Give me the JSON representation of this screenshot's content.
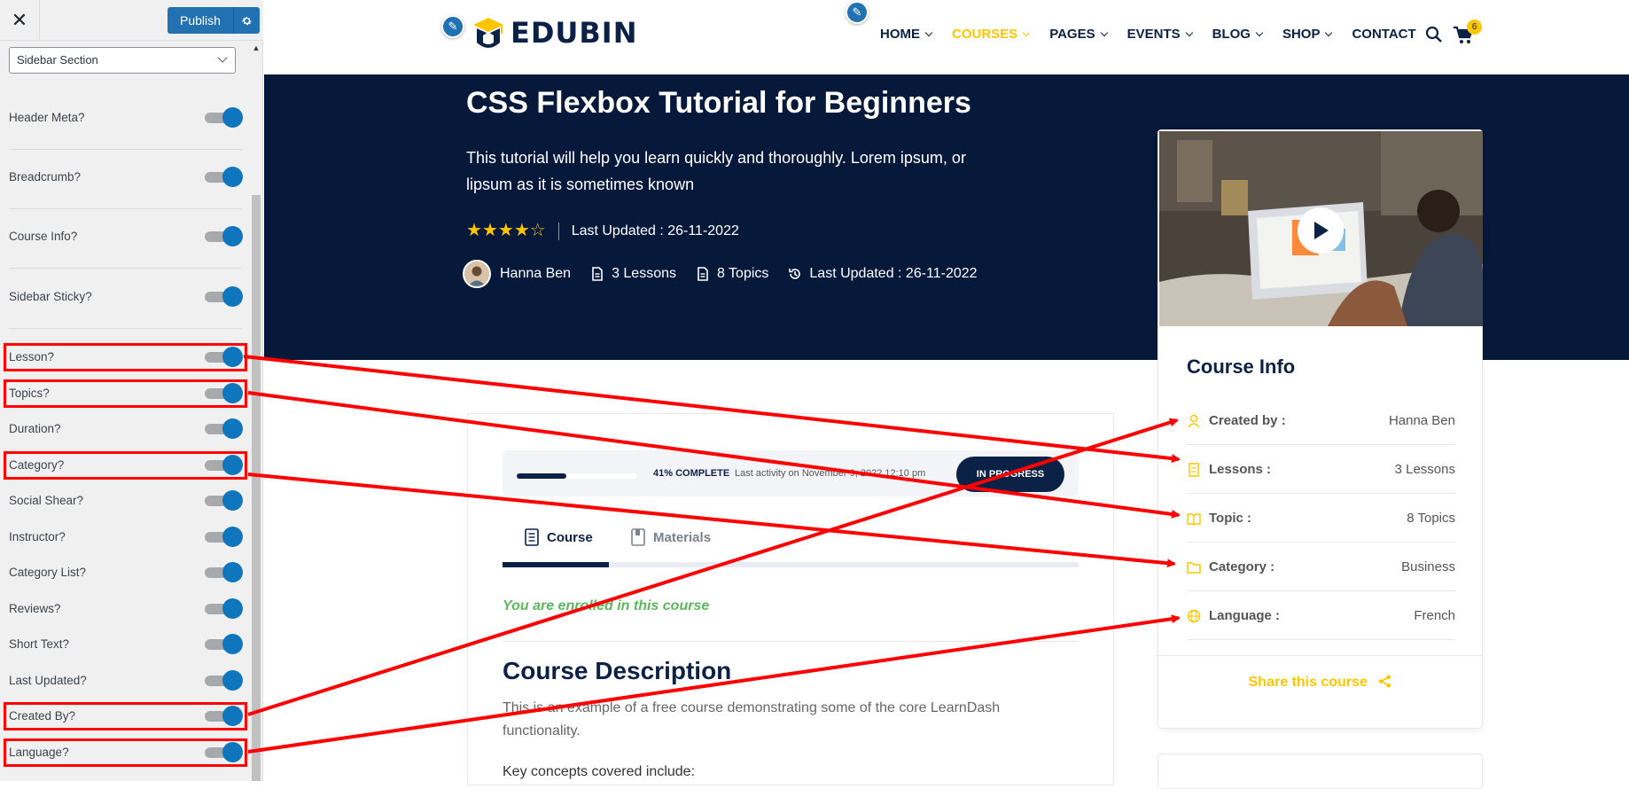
{
  "customizer": {
    "close_icon": "close-icon",
    "publish_label": "Publish",
    "section_select_value": "Sidebar Section",
    "toggles": [
      {
        "label": "Header Meta?",
        "on": true
      },
      {
        "label": "Breadcrumb?",
        "on": true
      },
      {
        "label": "Course Info?",
        "on": true
      },
      {
        "label": "Sidebar Sticky?",
        "on": true
      },
      {
        "label": "Lesson?",
        "on": true
      },
      {
        "label": "Topics?",
        "on": true
      },
      {
        "label": "Duration?",
        "on": true
      },
      {
        "label": "Category?",
        "on": true
      },
      {
        "label": "Social Shear?",
        "on": true
      },
      {
        "label": "Instructor?",
        "on": true
      },
      {
        "label": "Category List?",
        "on": true
      },
      {
        "label": "Reviews?",
        "on": true
      },
      {
        "label": "Short Text?",
        "on": true
      },
      {
        "label": "Last Updated?",
        "on": true
      },
      {
        "label": "Created By?",
        "on": true
      },
      {
        "label": "Language?",
        "on": true
      }
    ]
  },
  "site": {
    "logo_text": "EDUBIN",
    "nav": [
      {
        "label": "HOME",
        "dropdown": true,
        "active": false
      },
      {
        "label": "COURSES",
        "dropdown": true,
        "active": true
      },
      {
        "label": "PAGES",
        "dropdown": true,
        "active": false
      },
      {
        "label": "EVENTS",
        "dropdown": true,
        "active": false
      },
      {
        "label": "BLOG",
        "dropdown": true,
        "active": false
      },
      {
        "label": "SHOP",
        "dropdown": true,
        "active": false
      },
      {
        "label": "CONTACT",
        "dropdown": false,
        "active": false
      }
    ],
    "cart_count": "6",
    "colors": {
      "navy": "#07193b",
      "accent": "#ffc600",
      "wp_blue": "#2271b1",
      "annotation_red": "#ff0000"
    }
  },
  "hero": {
    "title": "CSS Flexbox Tutorial for Beginners",
    "subtitle": "This tutorial will help you learn quickly and thoroughly. Lorem ipsum, or lipsum as it is sometimes known",
    "rating": 4,
    "rating_max": 5,
    "last_updated": "Last Updated : 26-11-2022",
    "meta": {
      "author": "Hanna Ben",
      "lessons": "3 Lessons",
      "topics": "8 Topics",
      "updated": "Last Updated : 26-11-2022"
    }
  },
  "course_info": {
    "title": "Course Info",
    "rows": [
      {
        "key": "Created by :",
        "value": "Hanna Ben",
        "icon": "user-icon"
      },
      {
        "key": "Lessons :",
        "value": "3 Lessons",
        "icon": "lesson-icon"
      },
      {
        "key": "Topic :",
        "value": "8 Topics",
        "icon": "book-icon"
      },
      {
        "key": "Category :",
        "value": "Business",
        "icon": "folder-icon"
      },
      {
        "key": "Language :",
        "value": "French",
        "icon": "globe-icon"
      }
    ],
    "share_label": "Share this course"
  },
  "progress": {
    "percent_value": 0.41,
    "percent_label": "41% COMPLETE",
    "activity": "Last activity on November 9, 2022 12:10 pm",
    "status": "IN PROGRESS"
  },
  "tabs": [
    {
      "label": "Course",
      "active": true
    },
    {
      "label": "Materials",
      "active": false
    }
  ],
  "content": {
    "enrolled": "You are enrolled in this course",
    "desc_title": "Course Description",
    "desc_body": "This is an example of a free course demonstrating some of the core LearnDash functionality.",
    "key_concepts": "Key concepts covered include:"
  }
}
